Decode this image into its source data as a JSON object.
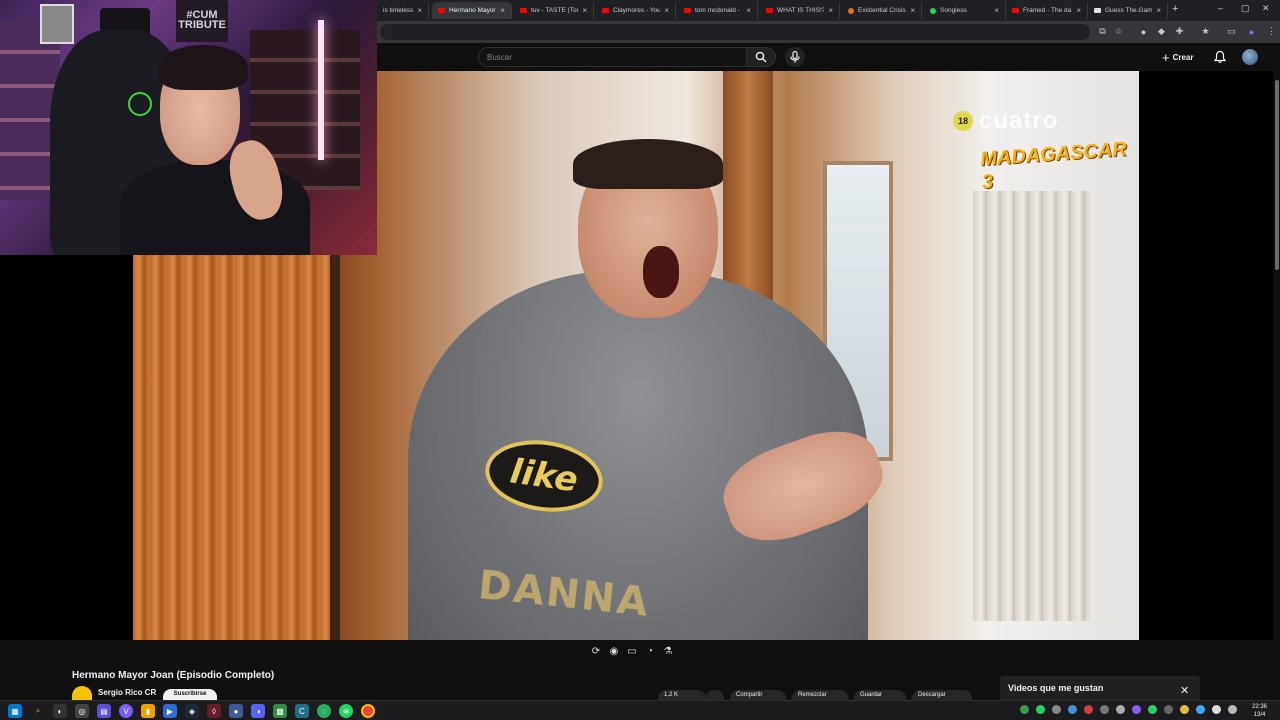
{
  "browser": {
    "tabs": [
      {
        "title": "is timeless, li",
        "icon": "generic"
      },
      {
        "title": "Hermano Mayor",
        "icon": "youtube",
        "active": true
      },
      {
        "title": "tuv - TASTE (Tom",
        "icon": "youtube"
      },
      {
        "title": "Claymores - YouT",
        "icon": "youtube"
      },
      {
        "title": "tom mcdonald -",
        "icon": "youtube"
      },
      {
        "title": "WHAT IS THIS!?",
        "icon": "youtube"
      },
      {
        "title": "Existential Crisis",
        "icon": "orange"
      },
      {
        "title": "Songless",
        "icon": "green"
      },
      {
        "title": "Framed - The da",
        "icon": "youtube"
      },
      {
        "title": "Guess The.Game",
        "icon": "generic"
      }
    ],
    "new_tab": "+",
    "minimize": "–",
    "maximize": "▢",
    "close": "✕"
  },
  "youtube": {
    "search_placeholder": "Buscar",
    "create_label": "Crear",
    "video_title": "Hermano Mayor Joan (Episodio Completo)",
    "channel_name": "Sergio Rico CR",
    "subscribe_label": "Suscribirse",
    "actions": [
      "1,2 K",
      "",
      "Compartir",
      "Remezclar",
      "Guardar",
      "Descargar"
    ],
    "toast_text": "Videos que me gustan"
  },
  "video_overlay": {
    "age_rating": "18",
    "channel_logo": "cuatro",
    "show_logo": "MADAGASCAR 3",
    "shirt_logo": "like",
    "shirt_text": "DANNA"
  },
  "webcam": {
    "poster_text": "#CUM\nTRIBUTE"
  },
  "taskbar": {
    "time": "22:36",
    "date": "13/4"
  },
  "colors": {
    "youtube_bg": "#0f0f0f",
    "browser_frame": "#202124",
    "accent_red": "#ff0000"
  }
}
